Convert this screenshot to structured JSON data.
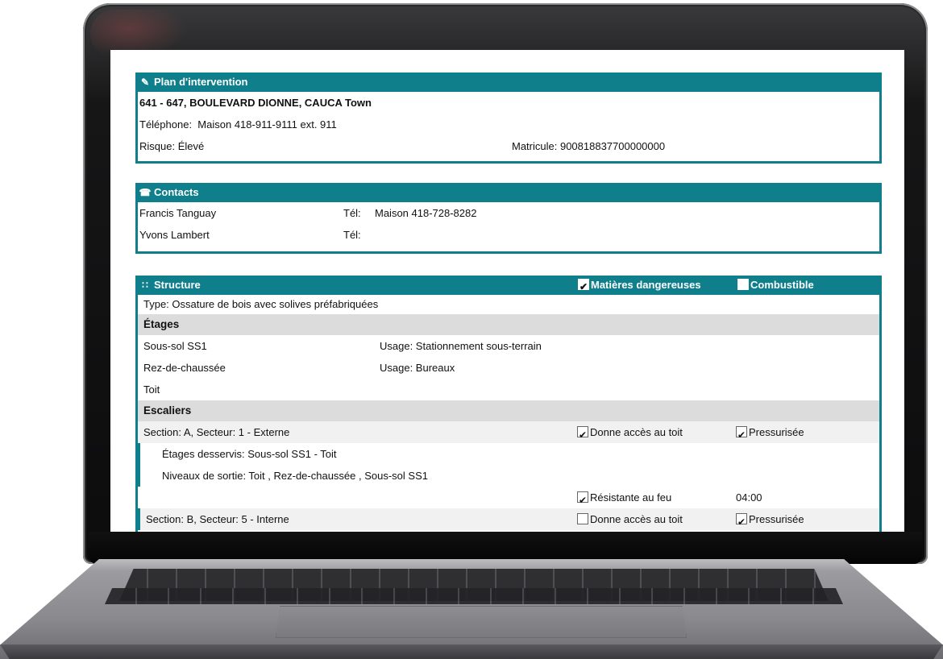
{
  "plan": {
    "title": "Plan d'intervention",
    "address": "641 - 647, BOULEVARD DIONNE, CAUCA Town",
    "telephone_label": "Téléphone:",
    "telephone_value": "Maison 418-911-9111 ext. 911",
    "risque": "Risque: Élevé",
    "matricule": "Matricule: 900818837700000000"
  },
  "contacts": {
    "title": "Contacts",
    "items": [
      {
        "name": "Francis Tanguay",
        "tel_label": "Tél:",
        "tel_value": "Maison 418-728-8282"
      },
      {
        "name": "Yvons Lambert",
        "tel_label": "Tél:",
        "tel_value": ""
      }
    ]
  },
  "structure": {
    "title": "Structure",
    "matieres_dangereuses": {
      "label": "Matières dangereuses",
      "checked": true
    },
    "combustible": {
      "label": "Combustible",
      "checked": false
    },
    "type": "Type: Ossature de bois avec solives préfabriquées",
    "etages_title": "Étages",
    "etages": [
      {
        "name": "Sous-sol SS1",
        "usage": "Usage: Stationnement sous-terrain"
      },
      {
        "name": "Rez-de-chaussée",
        "usage": "Usage: Bureaux"
      },
      {
        "name": "Toit",
        "usage": ""
      }
    ],
    "escaliers_title": "Escaliers",
    "escaliers": [
      {
        "section": "Section: A, Secteur: 1 - Externe",
        "acces_toit": {
          "label": "Donne accès au toit",
          "checked": true
        },
        "pressurisee": {
          "label": "Pressurisée",
          "checked": true
        },
        "etages_desservis": "Étages desservis: Sous-sol SS1 - Toit",
        "niveaux_sortie": "Niveaux de sortie: Toit , Rez-de-chaussée , Sous-sol SS1",
        "resistante": {
          "label": "Résistante au feu",
          "checked": true
        },
        "duree": "04:00"
      },
      {
        "section": "Section: B, Secteur: 5 - Interne",
        "acces_toit": {
          "label": "Donne accès au toit",
          "checked": false
        },
        "pressurisee": {
          "label": "Pressurisée",
          "checked": true
        }
      }
    ]
  },
  "icons": {
    "plan": "notepad-pencil-icon",
    "contacts": "phone-icon",
    "structure": "building-structure-icon"
  },
  "colors": {
    "header": "#0f7f8c",
    "subhead": "#dcdcdc"
  }
}
